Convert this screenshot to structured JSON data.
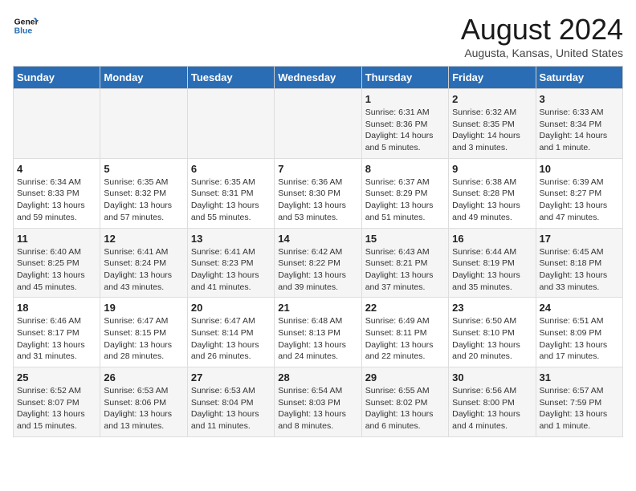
{
  "header": {
    "logo_line1": "General",
    "logo_line2": "Blue",
    "title": "August 2024",
    "subtitle": "Augusta, Kansas, United States"
  },
  "days_of_week": [
    "Sunday",
    "Monday",
    "Tuesday",
    "Wednesday",
    "Thursday",
    "Friday",
    "Saturday"
  ],
  "weeks": [
    [
      {
        "day": "",
        "info": ""
      },
      {
        "day": "",
        "info": ""
      },
      {
        "day": "",
        "info": ""
      },
      {
        "day": "",
        "info": ""
      },
      {
        "day": "1",
        "info": "Sunrise: 6:31 AM\nSunset: 8:36 PM\nDaylight: 14 hours\nand 5 minutes."
      },
      {
        "day": "2",
        "info": "Sunrise: 6:32 AM\nSunset: 8:35 PM\nDaylight: 14 hours\nand 3 minutes."
      },
      {
        "day": "3",
        "info": "Sunrise: 6:33 AM\nSunset: 8:34 PM\nDaylight: 14 hours\nand 1 minute."
      }
    ],
    [
      {
        "day": "4",
        "info": "Sunrise: 6:34 AM\nSunset: 8:33 PM\nDaylight: 13 hours\nand 59 minutes."
      },
      {
        "day": "5",
        "info": "Sunrise: 6:35 AM\nSunset: 8:32 PM\nDaylight: 13 hours\nand 57 minutes."
      },
      {
        "day": "6",
        "info": "Sunrise: 6:35 AM\nSunset: 8:31 PM\nDaylight: 13 hours\nand 55 minutes."
      },
      {
        "day": "7",
        "info": "Sunrise: 6:36 AM\nSunset: 8:30 PM\nDaylight: 13 hours\nand 53 minutes."
      },
      {
        "day": "8",
        "info": "Sunrise: 6:37 AM\nSunset: 8:29 PM\nDaylight: 13 hours\nand 51 minutes."
      },
      {
        "day": "9",
        "info": "Sunrise: 6:38 AM\nSunset: 8:28 PM\nDaylight: 13 hours\nand 49 minutes."
      },
      {
        "day": "10",
        "info": "Sunrise: 6:39 AM\nSunset: 8:27 PM\nDaylight: 13 hours\nand 47 minutes."
      }
    ],
    [
      {
        "day": "11",
        "info": "Sunrise: 6:40 AM\nSunset: 8:25 PM\nDaylight: 13 hours\nand 45 minutes."
      },
      {
        "day": "12",
        "info": "Sunrise: 6:41 AM\nSunset: 8:24 PM\nDaylight: 13 hours\nand 43 minutes."
      },
      {
        "day": "13",
        "info": "Sunrise: 6:41 AM\nSunset: 8:23 PM\nDaylight: 13 hours\nand 41 minutes."
      },
      {
        "day": "14",
        "info": "Sunrise: 6:42 AM\nSunset: 8:22 PM\nDaylight: 13 hours\nand 39 minutes."
      },
      {
        "day": "15",
        "info": "Sunrise: 6:43 AM\nSunset: 8:21 PM\nDaylight: 13 hours\nand 37 minutes."
      },
      {
        "day": "16",
        "info": "Sunrise: 6:44 AM\nSunset: 8:19 PM\nDaylight: 13 hours\nand 35 minutes."
      },
      {
        "day": "17",
        "info": "Sunrise: 6:45 AM\nSunset: 8:18 PM\nDaylight: 13 hours\nand 33 minutes."
      }
    ],
    [
      {
        "day": "18",
        "info": "Sunrise: 6:46 AM\nSunset: 8:17 PM\nDaylight: 13 hours\nand 31 minutes."
      },
      {
        "day": "19",
        "info": "Sunrise: 6:47 AM\nSunset: 8:15 PM\nDaylight: 13 hours\nand 28 minutes."
      },
      {
        "day": "20",
        "info": "Sunrise: 6:47 AM\nSunset: 8:14 PM\nDaylight: 13 hours\nand 26 minutes."
      },
      {
        "day": "21",
        "info": "Sunrise: 6:48 AM\nSunset: 8:13 PM\nDaylight: 13 hours\nand 24 minutes."
      },
      {
        "day": "22",
        "info": "Sunrise: 6:49 AM\nSunset: 8:11 PM\nDaylight: 13 hours\nand 22 minutes."
      },
      {
        "day": "23",
        "info": "Sunrise: 6:50 AM\nSunset: 8:10 PM\nDaylight: 13 hours\nand 20 minutes."
      },
      {
        "day": "24",
        "info": "Sunrise: 6:51 AM\nSunset: 8:09 PM\nDaylight: 13 hours\nand 17 minutes."
      }
    ],
    [
      {
        "day": "25",
        "info": "Sunrise: 6:52 AM\nSunset: 8:07 PM\nDaylight: 13 hours\nand 15 minutes."
      },
      {
        "day": "26",
        "info": "Sunrise: 6:53 AM\nSunset: 8:06 PM\nDaylight: 13 hours\nand 13 minutes."
      },
      {
        "day": "27",
        "info": "Sunrise: 6:53 AM\nSunset: 8:04 PM\nDaylight: 13 hours\nand 11 minutes."
      },
      {
        "day": "28",
        "info": "Sunrise: 6:54 AM\nSunset: 8:03 PM\nDaylight: 13 hours\nand 8 minutes."
      },
      {
        "day": "29",
        "info": "Sunrise: 6:55 AM\nSunset: 8:02 PM\nDaylight: 13 hours\nand 6 minutes."
      },
      {
        "day": "30",
        "info": "Sunrise: 6:56 AM\nSunset: 8:00 PM\nDaylight: 13 hours\nand 4 minutes."
      },
      {
        "day": "31",
        "info": "Sunrise: 6:57 AM\nSunset: 7:59 PM\nDaylight: 13 hours\nand 1 minute."
      }
    ]
  ]
}
